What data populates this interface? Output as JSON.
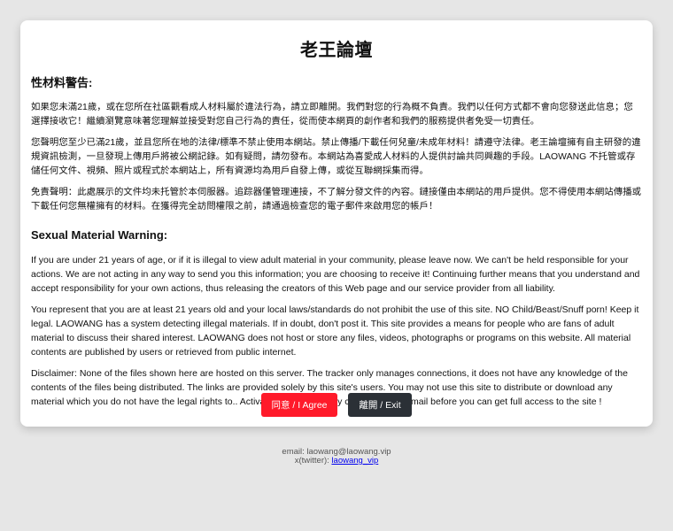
{
  "title": "老王論壇",
  "zh": {
    "heading": "性材料警告:",
    "paragraphs": [
      "如果您未滿21歲，或在您所在社區觀看成人材料屬於違法行為，請立即離開。我們對您的行為概不負責。我們以任何方式都不會向您發送此信息；您選擇接收它！繼續瀏覽意味著您理解並接受對您自己行為的責任，從而使本網頁的創作者和我們的服務提供者免受一切責任。",
      "您聲明您至少已滿21歲，並且您所在地的法律/標準不禁止使用本網站。禁止傳播/下載任何兒童/未成年材料！請遵守法律。老王論壇擁有自主研發的違規資訊檢測，一旦發現上傳用戶將被公網記錄。如有疑問，請勿發布。本網站為喜愛成人材料的人提供討論共同興趣的手段。LAOWANG 不托管或存儲任何文件、視頻、照片或程式於本網站上，所有資源均為用戶自發上傳，或從互聯網採集而得。",
      "免責聲明：此處展示的文件均未托管於本伺服器。追踪器僅管理連接，不了解分發文件的內容。鏈接僅由本網站的用戶提供。您不得使用本網站傳播或下載任何您無權擁有的材料。在獲得完全訪問權限之前，請通過檢查您的電子郵件來啟用您的帳戶！"
    ]
  },
  "en": {
    "heading": "Sexual Material Warning:",
    "paragraphs": [
      "If you are under 21 years of age, or if it is illegal to view adult material in your community, please leave now. We can't be held responsible for your actions. We are not acting in any way to send you this information; you are choosing to receive it! Continuing further means that you understand and accept responsibility for your own actions, thus releasing the creators of this Web page and our service provider from all liability.",
      "You represent that you are at least 21 years old and your local laws/standards do not prohibit the use of this site. NO Child/Beast/Snuff porn! Keep it legal. LAOWANG has a system detecting illegal materials. If in doubt, don't post it. This site provides a means for people who are fans of adult material to discuss their shared interest. LAOWANG does not host or store any files, videos, photographs or programs on this website. All material contents are published by users or retrieved from public internet.",
      "Disclaimer: None of the files shown here are hosted on this server. The tracker only manages connections, it does not have any knowledge of the contents of the files being distributed. The links are provided solely by this site's users. You may not use this site to distribute or download any material which you do not have the legal rights to.. Activate Your Account by checking your Email before you can get full access to the site !"
    ]
  },
  "buttons": {
    "agree": "同意 / I Agree",
    "exit": "離開 / Exit"
  },
  "footer": {
    "email_line": "email: laowang@laowang.vip",
    "twitter_prefix": "x(twitter): ",
    "twitter_handle": "laowang_vip"
  },
  "colors": {
    "agree_button": "#ff1a2a",
    "exit_button": "#2b3036",
    "background": "#e6e6e6"
  }
}
